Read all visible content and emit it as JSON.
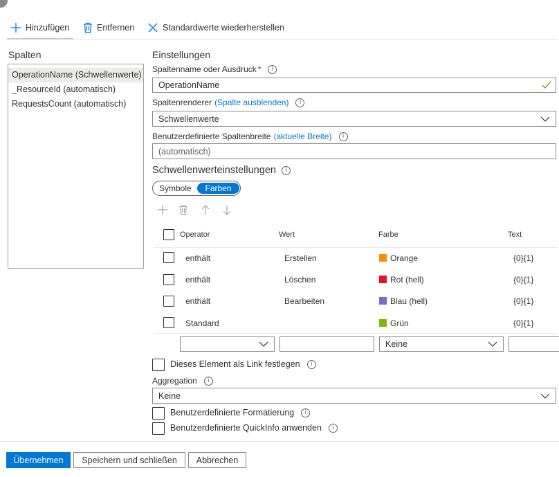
{
  "toolbar": {
    "add_label": "Hinzufügen",
    "remove_label": "Entfernen",
    "reset_label": "Standardwerte wiederherstellen"
  },
  "columns": {
    "title": "Spalten",
    "items": [
      {
        "label": "OperationName (Schwellenwerte)",
        "selected": true
      },
      {
        "label": "_ResourceId (automatisch)",
        "selected": false
      },
      {
        "label": "RequestsCount (automatisch)",
        "selected": false
      }
    ]
  },
  "settings": {
    "title": "Einstellungen",
    "column_name_label": "Spaltenname oder Ausdruck",
    "required_marker": "*",
    "column_name_value": "OperationName",
    "renderer_label": "Spaltenrenderer",
    "renderer_link": "(Spalte ausblenden)",
    "renderer_value": "Schwellenwerte",
    "width_label": "Benutzerdefinierte Spaltenbreite",
    "width_link": "(aktuelle Breite)",
    "width_placeholder": "(automatisch)"
  },
  "thresholds": {
    "title": "Schwellenwerteinstellungen",
    "toggle": {
      "options": [
        "Symbole",
        "Farben"
      ],
      "selected": "Farben"
    },
    "headers": {
      "operator": "Operator",
      "value": "Wert",
      "color": "Farbe",
      "text": "Text"
    },
    "rows": [
      {
        "operator": "enthält",
        "value": "Erstellen",
        "color_name": "Orange",
        "color": "#ff8c00",
        "text": "{0}{1}"
      },
      {
        "operator": "enthält",
        "value": "Löschen",
        "color_name": "Rot (hell)",
        "color": "#e81123",
        "text": "{0}{1}"
      },
      {
        "operator": "enthält",
        "value": "Bearbeiten",
        "color_name": "Blau (hell)",
        "color": "#7072c7",
        "text": "{0}{1}"
      },
      {
        "operator": "Standard",
        "value": "",
        "color_name": "Grün",
        "color": "#7fba00",
        "text": "{0}{1}"
      }
    ],
    "new_row": {
      "operator": "",
      "value": "",
      "color": "Keine",
      "text": ""
    }
  },
  "options": {
    "link_label": "Dieses Element als Link festlegen",
    "aggregation_label": "Aggregation",
    "aggregation_value": "Keine",
    "custom_format_label": "Benutzerdefinierte Formatierung",
    "custom_tooltip_label": "Benutzerdefinierte QuickInfo anwenden"
  },
  "footer": {
    "apply_label": "Übernehmen",
    "save_close_label": "Speichern und schließen",
    "cancel_label": "Abbrechen"
  },
  "colors": {
    "accent": "#0078d4"
  }
}
